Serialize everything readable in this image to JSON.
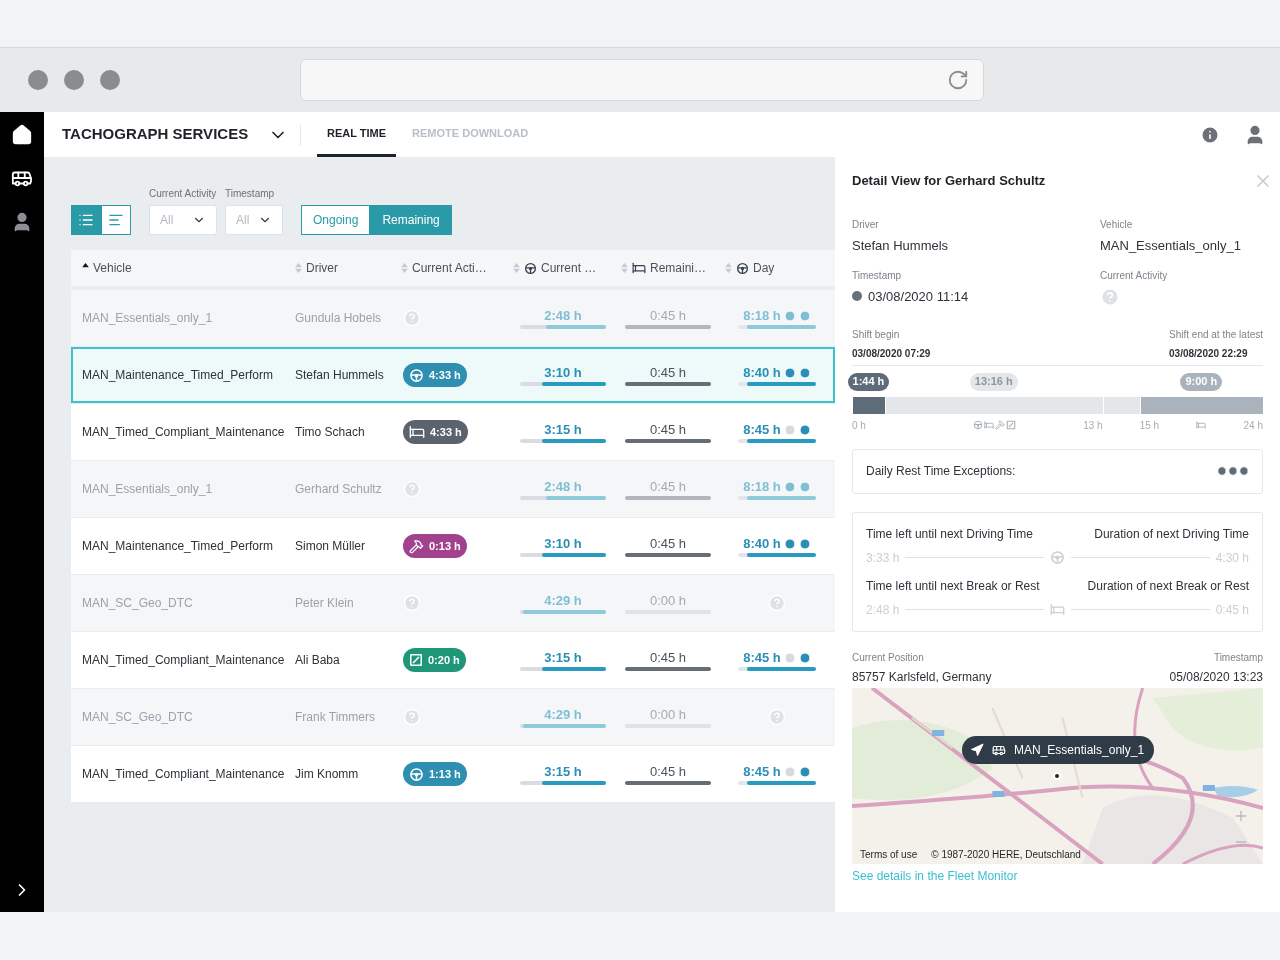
{
  "header": {
    "title": "TACHOGRAPH SERVICES",
    "tabs": [
      {
        "label": "REAL TIME",
        "selected": true
      },
      {
        "label": "REMOTE DOWNLOAD",
        "selected": false
      }
    ]
  },
  "toolbar": {
    "views": [
      {
        "kind": "list",
        "selected": true
      },
      {
        "kind": "chart",
        "selected": false
      }
    ],
    "filters": [
      {
        "label": "Current Activity",
        "value": "All"
      },
      {
        "label": "Timestamp",
        "value": "All"
      }
    ],
    "modes": [
      {
        "label": "Ongoing",
        "selected": false
      },
      {
        "label": "Remaining",
        "selected": true
      }
    ]
  },
  "table": {
    "columns": [
      {
        "label": "Vehicle",
        "kind": "plain",
        "sorted": true
      },
      {
        "label": "Driver",
        "kind": "plain",
        "sorted": false
      },
      {
        "label": "Current Acti…",
        "kind": "plain",
        "sorted": false
      },
      {
        "label": "Current …",
        "kind": "driving",
        "sorted": false
      },
      {
        "label": "Remaini…",
        "kind": "rest",
        "sorted": false
      },
      {
        "label": "Day",
        "kind": "driving",
        "sorted": false
      }
    ],
    "rows": [
      {
        "vehicle": "MAN_Essentials_only_1",
        "driver": "Gundula Hobels",
        "activity": {
          "kind": "unknown"
        },
        "current": {
          "text": "2:48 h",
          "level": 0.7
        },
        "remaining": "0:45 h",
        "day": {
          "text": "8:18 h",
          "level": 0.88
        },
        "day_icons": [
          {
            "on": true
          },
          {
            "on": true
          }
        ],
        "dim": true,
        "selected": false
      },
      {
        "vehicle": "MAN_Maintenance_Timed_Perform",
        "driver": "Stefan Hummels",
        "activity": {
          "kind": "driving",
          "time": "4:33 h"
        },
        "current": {
          "text": "3:10 h",
          "level": 0.75
        },
        "remaining": "0:45 h",
        "day": {
          "text": "8:40 h",
          "level": 0.88
        },
        "day_icons": [
          {
            "on": true
          },
          {
            "on": true
          }
        ],
        "dim": false,
        "selected": true
      },
      {
        "vehicle": "MAN_Timed_Compliant_Maintenance",
        "driver": "Timo Schach",
        "activity": {
          "kind": "rest",
          "time": "4:33 h"
        },
        "current": {
          "text": "3:15 h",
          "level": 0.75
        },
        "remaining": "0:45 h",
        "day": {
          "text": "8:45 h",
          "level": 0.88
        },
        "day_icons": [
          {
            "on": false
          },
          {
            "on": true
          }
        ],
        "dim": false,
        "selected": false
      },
      {
        "vehicle": "MAN_Essentials_only_1",
        "driver": "Gerhard Schultz",
        "activity": {
          "kind": "unknown"
        },
        "current": {
          "text": "2:48 h",
          "level": 0.7
        },
        "remaining": "0:45 h",
        "day": {
          "text": "8:18 h",
          "level": 0.88
        },
        "day_icons": [
          {
            "on": true
          },
          {
            "on": true
          }
        ],
        "dim": true,
        "selected": false
      },
      {
        "vehicle": "MAN_Maintenance_Timed_Perform",
        "driver": "Simon Müller",
        "activity": {
          "kind": "work",
          "time": "0:13 h"
        },
        "current": {
          "text": "3:10 h",
          "level": 0.75
        },
        "remaining": "0:45 h",
        "day": {
          "text": "8:40 h",
          "level": 0.88
        },
        "day_icons": [
          {
            "on": true
          },
          {
            "on": true
          }
        ],
        "dim": false,
        "selected": false
      },
      {
        "vehicle": "MAN_SC_Geo_DTC",
        "driver": "Peter Klein",
        "activity": {
          "kind": "unknown"
        },
        "current": {
          "text": "4:29 h",
          "level": 0.97
        },
        "remaining": "0:00 h",
        "dim": true,
        "selected": false
      },
      {
        "vehicle": "MAN_Timed_Compliant_Maintenance",
        "driver": "Ali Baba",
        "activity": {
          "kind": "available",
          "time": "0:20 h"
        },
        "current": {
          "text": "3:15 h",
          "level": 0.75
        },
        "remaining": "0:45 h",
        "day": {
          "text": "8:45 h",
          "level": 0.88
        },
        "day_icons": [
          {
            "on": false
          },
          {
            "on": true
          }
        ],
        "dim": false,
        "selected": false
      },
      {
        "vehicle": "MAN_SC_Geo_DTC",
        "driver": "Frank Timmers",
        "activity": {
          "kind": "unknown"
        },
        "current": {
          "text": "4:29 h",
          "level": 0.97
        },
        "remaining": "0:00 h",
        "dim": true,
        "selected": false
      },
      {
        "vehicle": "MAN_Timed_Compliant_Maintenance",
        "driver": "Jim Knomm",
        "activity": {
          "kind": "driving",
          "time": "1:13 h"
        },
        "current": {
          "text": "3:15 h",
          "level": 0.75
        },
        "remaining": "0:45 h",
        "day": {
          "text": "8:45 h",
          "level": 0.88
        },
        "day_icons": [
          {
            "on": false
          },
          {
            "on": true
          }
        ],
        "dim": false,
        "selected": false
      }
    ]
  },
  "detail": {
    "title": "Detail View for Gerhard Schultz",
    "fields": [
      {
        "label": "Driver",
        "value": "Stefan Hummels",
        "kind": "text"
      },
      {
        "label": "Vehicle",
        "value": "MAN_Essentials_only_1",
        "kind": "text"
      },
      {
        "label": "Timestamp",
        "value": "03/08/2020 11:14",
        "kind": "status"
      },
      {
        "label": "Current Activity",
        "kind": "unknown"
      }
    ],
    "shift": {
      "begin_label": "Shift begin",
      "begin_value": "03/08/2020 07:29",
      "end_label": "Shift end at the latest",
      "end_value": "03/08/2020 22:29",
      "segments": [
        {
          "label": "1:44 h",
          "kind": "driving"
        },
        {
          "label": "13:16 h",
          "kind": "available"
        },
        {
          "kind": "available"
        },
        {
          "label": "9:00 h",
          "kind": "rest"
        }
      ],
      "axis": [
        {
          "start": "0 h",
          "end": "13 h",
          "kind": "activities"
        },
        {
          "start": "15 h",
          "end": "24 h",
          "kind": "rest"
        }
      ]
    },
    "exceptions": {
      "label": "Daily Rest Time Exceptions:",
      "icons": [
        {
          "on": true
        },
        {
          "on": true
        },
        {
          "on": true
        }
      ]
    },
    "next": [
      {
        "left_label": "Time left until next Driving Time",
        "left_value": "3:33 h",
        "right_label": "Duration of next Driving Time",
        "right_value": "4:30 h",
        "kind": "driving"
      },
      {
        "left_label": "Time left until next Break or Rest",
        "left_value": "2:48 h",
        "right_label": "Duration of next Break or Rest",
        "right_value": "0:45 h",
        "kind": "rest"
      }
    ],
    "position": {
      "label": "Current Position",
      "value": "85757 Karlsfeld, Germany",
      "timestamp_label": "Timestamp",
      "timestamp": "05/08/2020 13:23",
      "marker": "MAN_Essentials_only_1",
      "terms": "Terms of use",
      "copyright": "© 1987-2020 HERE, Deutschland"
    },
    "link": "See details in the Fleet Monitor"
  }
}
